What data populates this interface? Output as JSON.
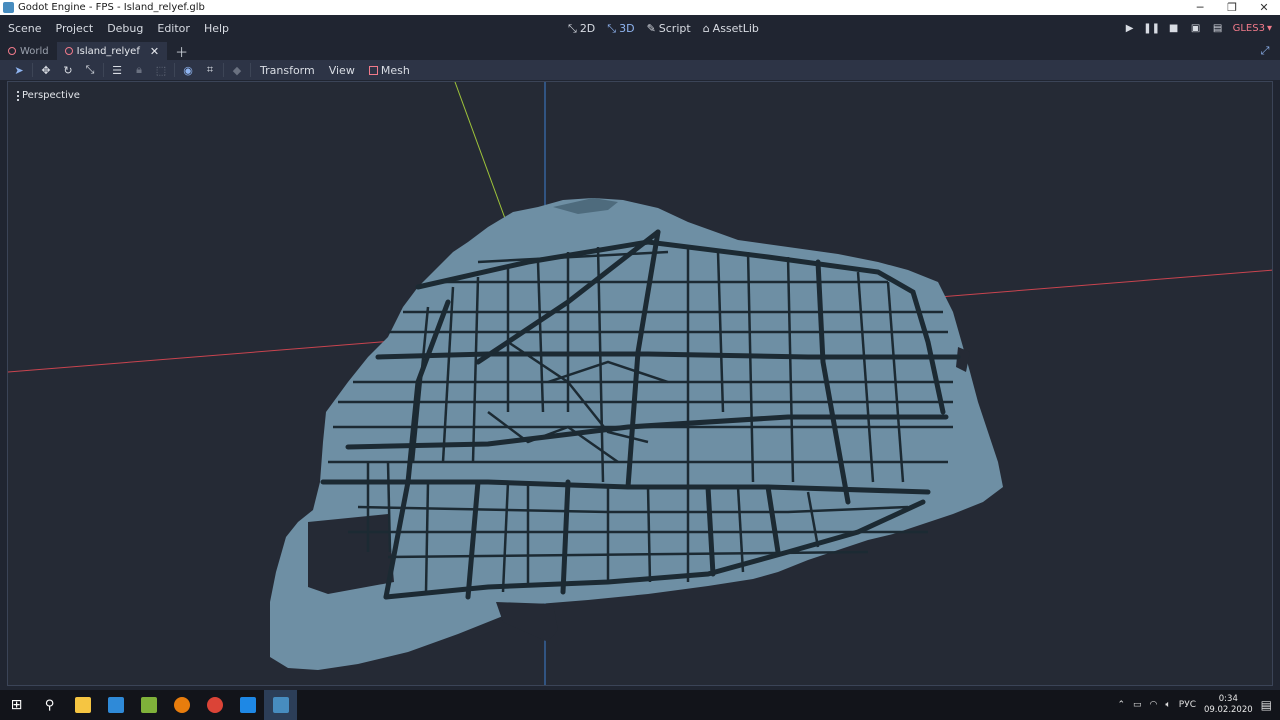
{
  "window": {
    "title": "Godot Engine - FPS - Island_relyef.glb"
  },
  "menu": {
    "items": [
      "Scene",
      "Project",
      "Debug",
      "Editor",
      "Help"
    ]
  },
  "workspaces": [
    {
      "label": "2D",
      "icon": "2d-icon",
      "active": false
    },
    {
      "label": "3D",
      "icon": "3d-icon",
      "active": true
    },
    {
      "label": "Script",
      "icon": "script-icon",
      "active": false
    },
    {
      "label": "AssetLib",
      "icon": "assetlib-icon",
      "active": false
    }
  ],
  "renderer": {
    "label": "GLES3"
  },
  "scene_tabs": [
    {
      "label": "World",
      "active": false
    },
    {
      "label": "Island_relyef",
      "active": true
    }
  ],
  "toolbar": {
    "menus": [
      "Transform",
      "View",
      "Mesh"
    ]
  },
  "viewport": {
    "perspective_label": "Perspective"
  },
  "taskbar": {
    "lang": "РУС",
    "time": "0:34",
    "date": "09.02.2020"
  },
  "colors": {
    "editor_bg": "#202531",
    "viewport_bg": "#252a35",
    "accent": "#8fb4f0",
    "mesh": "#6e8fa4",
    "roads": "#1c2a33",
    "x_axis": "#c9444f",
    "y_axis": "#9ec33a",
    "z_axis": "#3d7fd0"
  }
}
